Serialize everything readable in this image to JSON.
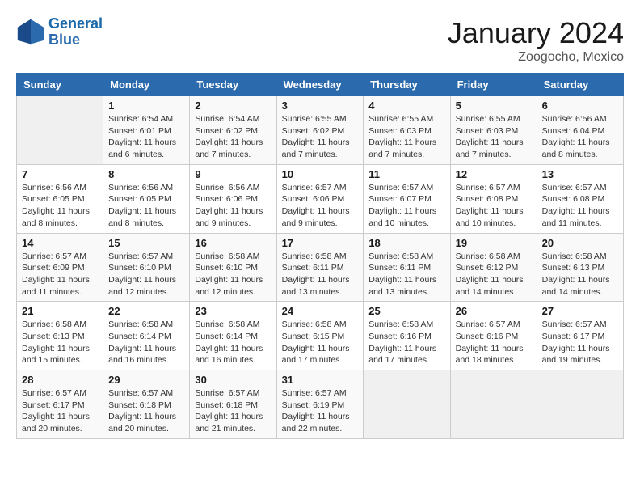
{
  "header": {
    "logo_line1": "General",
    "logo_line2": "Blue",
    "month_title": "January 2024",
    "location": "Zoogocho, Mexico"
  },
  "days_of_week": [
    "Sunday",
    "Monday",
    "Tuesday",
    "Wednesday",
    "Thursday",
    "Friday",
    "Saturday"
  ],
  "weeks": [
    [
      {
        "day": "",
        "info": ""
      },
      {
        "day": "1",
        "info": "Sunrise: 6:54 AM\nSunset: 6:01 PM\nDaylight: 11 hours\nand 6 minutes."
      },
      {
        "day": "2",
        "info": "Sunrise: 6:54 AM\nSunset: 6:02 PM\nDaylight: 11 hours\nand 7 minutes."
      },
      {
        "day": "3",
        "info": "Sunrise: 6:55 AM\nSunset: 6:02 PM\nDaylight: 11 hours\nand 7 minutes."
      },
      {
        "day": "4",
        "info": "Sunrise: 6:55 AM\nSunset: 6:03 PM\nDaylight: 11 hours\nand 7 minutes."
      },
      {
        "day": "5",
        "info": "Sunrise: 6:55 AM\nSunset: 6:03 PM\nDaylight: 11 hours\nand 7 minutes."
      },
      {
        "day": "6",
        "info": "Sunrise: 6:56 AM\nSunset: 6:04 PM\nDaylight: 11 hours\nand 8 minutes."
      }
    ],
    [
      {
        "day": "7",
        "info": "Sunrise: 6:56 AM\nSunset: 6:05 PM\nDaylight: 11 hours\nand 8 minutes."
      },
      {
        "day": "8",
        "info": "Sunrise: 6:56 AM\nSunset: 6:05 PM\nDaylight: 11 hours\nand 8 minutes."
      },
      {
        "day": "9",
        "info": "Sunrise: 6:56 AM\nSunset: 6:06 PM\nDaylight: 11 hours\nand 9 minutes."
      },
      {
        "day": "10",
        "info": "Sunrise: 6:57 AM\nSunset: 6:06 PM\nDaylight: 11 hours\nand 9 minutes."
      },
      {
        "day": "11",
        "info": "Sunrise: 6:57 AM\nSunset: 6:07 PM\nDaylight: 11 hours\nand 10 minutes."
      },
      {
        "day": "12",
        "info": "Sunrise: 6:57 AM\nSunset: 6:08 PM\nDaylight: 11 hours\nand 10 minutes."
      },
      {
        "day": "13",
        "info": "Sunrise: 6:57 AM\nSunset: 6:08 PM\nDaylight: 11 hours\nand 11 minutes."
      }
    ],
    [
      {
        "day": "14",
        "info": "Sunrise: 6:57 AM\nSunset: 6:09 PM\nDaylight: 11 hours\nand 11 minutes."
      },
      {
        "day": "15",
        "info": "Sunrise: 6:57 AM\nSunset: 6:10 PM\nDaylight: 11 hours\nand 12 minutes."
      },
      {
        "day": "16",
        "info": "Sunrise: 6:58 AM\nSunset: 6:10 PM\nDaylight: 11 hours\nand 12 minutes."
      },
      {
        "day": "17",
        "info": "Sunrise: 6:58 AM\nSunset: 6:11 PM\nDaylight: 11 hours\nand 13 minutes."
      },
      {
        "day": "18",
        "info": "Sunrise: 6:58 AM\nSunset: 6:11 PM\nDaylight: 11 hours\nand 13 minutes."
      },
      {
        "day": "19",
        "info": "Sunrise: 6:58 AM\nSunset: 6:12 PM\nDaylight: 11 hours\nand 14 minutes."
      },
      {
        "day": "20",
        "info": "Sunrise: 6:58 AM\nSunset: 6:13 PM\nDaylight: 11 hours\nand 14 minutes."
      }
    ],
    [
      {
        "day": "21",
        "info": "Sunrise: 6:58 AM\nSunset: 6:13 PM\nDaylight: 11 hours\nand 15 minutes."
      },
      {
        "day": "22",
        "info": "Sunrise: 6:58 AM\nSunset: 6:14 PM\nDaylight: 11 hours\nand 16 minutes."
      },
      {
        "day": "23",
        "info": "Sunrise: 6:58 AM\nSunset: 6:14 PM\nDaylight: 11 hours\nand 16 minutes."
      },
      {
        "day": "24",
        "info": "Sunrise: 6:58 AM\nSunset: 6:15 PM\nDaylight: 11 hours\nand 17 minutes."
      },
      {
        "day": "25",
        "info": "Sunrise: 6:58 AM\nSunset: 6:16 PM\nDaylight: 11 hours\nand 17 minutes."
      },
      {
        "day": "26",
        "info": "Sunrise: 6:57 AM\nSunset: 6:16 PM\nDaylight: 11 hours\nand 18 minutes."
      },
      {
        "day": "27",
        "info": "Sunrise: 6:57 AM\nSunset: 6:17 PM\nDaylight: 11 hours\nand 19 minutes."
      }
    ],
    [
      {
        "day": "28",
        "info": "Sunrise: 6:57 AM\nSunset: 6:17 PM\nDaylight: 11 hours\nand 20 minutes."
      },
      {
        "day": "29",
        "info": "Sunrise: 6:57 AM\nSunset: 6:18 PM\nDaylight: 11 hours\nand 20 minutes."
      },
      {
        "day": "30",
        "info": "Sunrise: 6:57 AM\nSunset: 6:18 PM\nDaylight: 11 hours\nand 21 minutes."
      },
      {
        "day": "31",
        "info": "Sunrise: 6:57 AM\nSunset: 6:19 PM\nDaylight: 11 hours\nand 22 minutes."
      },
      {
        "day": "",
        "info": ""
      },
      {
        "day": "",
        "info": ""
      },
      {
        "day": "",
        "info": ""
      }
    ]
  ]
}
